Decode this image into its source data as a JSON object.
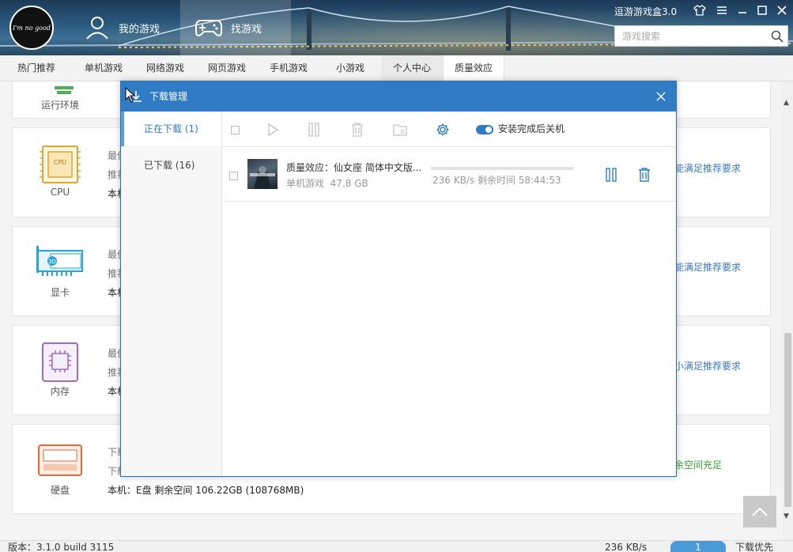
{
  "app": {
    "title": "逗游游戏盒3.0",
    "logo_text": "I'm no good"
  },
  "header": {
    "tabs": [
      {
        "label": "我的游戏",
        "icon": "user-icon",
        "active": false
      },
      {
        "label": "找游戏",
        "icon": "gamepad-icon",
        "active": true
      }
    ],
    "search": {
      "placeholder": "游戏搜索",
      "value": ""
    }
  },
  "subnav": {
    "items": [
      {
        "label": "热门推荐"
      },
      {
        "label": "单机游戏"
      },
      {
        "label": "网络游戏"
      },
      {
        "label": "网页游戏"
      },
      {
        "label": "手机游戏"
      },
      {
        "label": "小游戏"
      },
      {
        "label": "个人中心"
      },
      {
        "label": "质量效应",
        "active": true
      }
    ]
  },
  "requirements": {
    "runtime_label": "运行环境",
    "cards": [
      {
        "label": "CPU",
        "icon": "cpu-icon",
        "row1": "最佳",
        "row2": "推荐",
        "row3": "本机",
        "status": "能满足推荐要求"
      },
      {
        "label": "显卡",
        "icon": "graphics-card-icon",
        "row1": "最佳",
        "row2": "推荐",
        "row3": "本机",
        "status": "能满足推荐要求"
      },
      {
        "label": "内存",
        "icon": "memory-icon",
        "row1": "最佳",
        "row2": "推荐",
        "row3": "本机",
        "status": "小满足推荐要求"
      },
      {
        "label": "硬盘",
        "icon": "hard-disk-icon",
        "row1": "下载",
        "row2": "下载",
        "row3": "本机：E盘 剩余空间 106.22GB (108768MB)",
        "status": "余空间充足"
      }
    ]
  },
  "dialog": {
    "title": "下载管理",
    "tabs": [
      {
        "label": "正在下载 (1)",
        "active": true
      },
      {
        "label": "已下载 (16)",
        "active": false
      }
    ],
    "toolbar": {
      "auto_shutdown_label": "安装完成后关机",
      "auto_shutdown_on": true
    },
    "downloads": [
      {
        "name": "质量效应：仙女座  简体中文版...",
        "category": "单机游戏",
        "size": "47.8 GB",
        "speed_text": "236 KB/s  剩余时间 58:44:53",
        "progress": 0.0
      }
    ]
  },
  "statusbar": {
    "version": "版本：3.1.0 build 3115",
    "speed": "236 KB/s",
    "pill": "1",
    "priority": "下载优先"
  },
  "colors": {
    "accent": "#2f7cc4",
    "link": "#3a7bc8",
    "ok": "#3ba33b"
  }
}
